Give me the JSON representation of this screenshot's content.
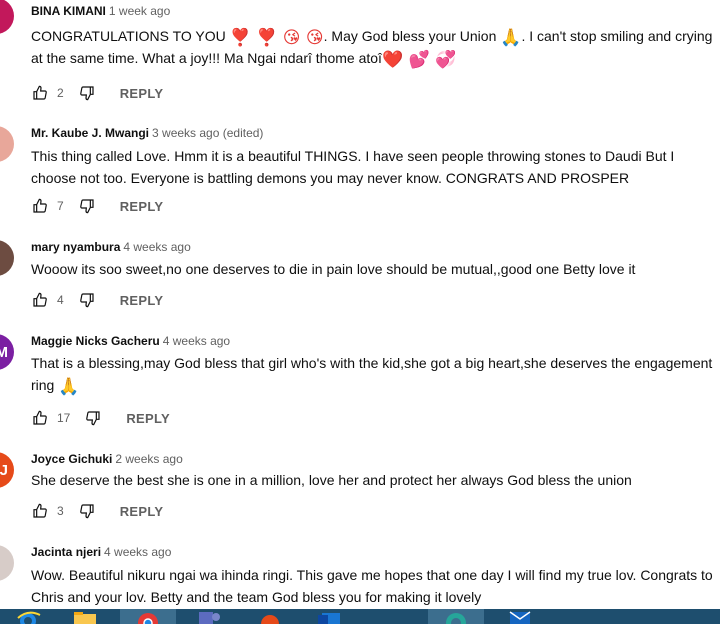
{
  "comments": [
    {
      "author": "BINA KIMANI",
      "time": "1 week ago",
      "avatar_color": "#c2185b",
      "avatar_letter": "",
      "text_parts": {
        "a": "CONGRATULATIONS TO YOU ",
        "e1": "❣️ ❣️ 😘 😘",
        "b": ". May God bless your Union ",
        "e2": "🙏",
        "c": ". I can't stop smiling and crying at the same time. What a joy!!! Ma Ngai ndarî thome atoî",
        "e3": "❤️ 💕 💞"
      },
      "likes": "2",
      "reply_label": "REPLY"
    },
    {
      "author": "Mr. Kaube J. Mwangi",
      "time": "3 weeks ago (edited)",
      "avatar_color": "#e8a79a",
      "avatar_letter": "",
      "text": "This thing called Love. Hmm it is a beautiful THINGS. I have seen people throwing stones to Daudi But I choose not too. Everyone is battling demons you may never know. CONGRATS AND PROSPER",
      "likes": "7",
      "reply_label": "REPLY"
    },
    {
      "author": "mary nyambura",
      "time": "4 weeks ago",
      "avatar_color": "#6d4c41",
      "avatar_letter": "",
      "text": "Wooow its soo sweet,no one deserves to die in pain love should be mutual,,good one Betty love it",
      "likes": "4",
      "reply_label": "REPLY"
    },
    {
      "author": "Maggie Nicks Gacheru",
      "time": "4 weeks ago",
      "avatar_color": "#7b1fa2",
      "avatar_letter": "M",
      "text": "That is a blessing,may God bless that girl who's with the kid,she got a big heart,she deserves the engagement ring ",
      "emoji": "🙏",
      "likes": "17",
      "reply_label": "REPLY"
    },
    {
      "author": "Joyce Gichuki",
      "time": "2 weeks ago",
      "avatar_color": "#e64a19",
      "avatar_letter": "J",
      "text": "She deserve the best she is one in a million, love her and protect her always God bless the union",
      "likes": "3",
      "reply_label": "REPLY"
    },
    {
      "author": "Jacinta njeri",
      "time": "4 weeks ago",
      "avatar_color": "#d7ccc8",
      "avatar_letter": "",
      "text": "Wow. Beautiful nikuru ngai wa ihinda ringi. This gave me hopes that one day I will find my true lov. Congrats to Chris and your lov. Betty and the team God bless you for making it lovely"
    }
  ],
  "colors": {
    "text_primary": "#0f0f0f",
    "text_secondary": "#606060",
    "taskbar": "#1e4e6e"
  },
  "icons": {
    "like": "thumb-up-icon",
    "dislike": "thumb-down-icon"
  },
  "taskbar_apps": [
    "internet-explorer-icon",
    "file-explorer-icon",
    "chrome-icon",
    "teams-icon",
    "office-icon",
    "outlook-icon",
    "edge-icon",
    "mail-icon"
  ]
}
